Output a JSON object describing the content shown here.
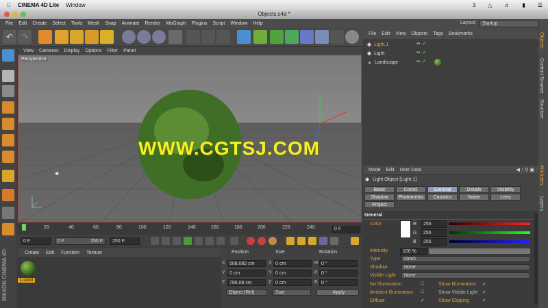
{
  "mac": {
    "app_name": "CINEMA 4D Lite",
    "menu_window": "Window",
    "status_count": "3"
  },
  "window": {
    "title": "Objects.c4d *"
  },
  "app_menu": [
    "File",
    "Edit",
    "Create",
    "Select",
    "Tools",
    "Mesh",
    "Snap",
    "Animate",
    "Render",
    "MoGraph",
    "Plugins",
    "Script",
    "Window",
    "Help"
  ],
  "layout": {
    "label": "Layout:",
    "value": "Startup"
  },
  "viewport": {
    "menu": [
      "View",
      "Cameras",
      "Display",
      "Options",
      "Filter",
      "Panel"
    ],
    "label": "Perspective",
    "watermark": "WWW.CGTSJ.COM"
  },
  "timeline": {
    "ticks": [
      "0",
      "20",
      "40",
      "60",
      "80",
      "100",
      "120",
      "140",
      "160",
      "180",
      "200",
      "220",
      "240"
    ],
    "current_frame": "0 F"
  },
  "transport": {
    "start": "0 F",
    "min": "0 F",
    "max": "250 F",
    "end": "250 F"
  },
  "material": {
    "menu": [
      "Create",
      "Edit",
      "Function",
      "Texture"
    ],
    "name": "Lizard",
    "maxon_logo": "MAXON CINEMA 4D"
  },
  "coordinates": {
    "headers": {
      "position": "Position",
      "size": "Size",
      "rotation": "Rotation"
    },
    "rows": [
      {
        "axis": "X",
        "pos": "508.082 cm",
        "size_axis": "X",
        "size": "0 cm",
        "rot_axis": "H",
        "rot": "0 °"
      },
      {
        "axis": "Y",
        "pos": "0 cm",
        "size_axis": "Y",
        "size": "0 cm",
        "rot_axis": "P",
        "rot": "0 °"
      },
      {
        "axis": "Z",
        "pos": "786.08 cm",
        "size_axis": "Z",
        "size": "0 cm",
        "rot_axis": "B",
        "rot": "0 °"
      }
    ],
    "mode": "Object (Rel)",
    "size_mode": "Size",
    "apply": "Apply"
  },
  "objects": {
    "menu": [
      "File",
      "Edit",
      "View",
      "Objects",
      "Tags",
      "Bookmarks"
    ],
    "items": [
      {
        "name": "Light.1"
      },
      {
        "name": "Light"
      },
      {
        "name": "Landscape"
      }
    ]
  },
  "right_tabs": [
    "Objects",
    "Content Browser",
    "Structure",
    "Attributes",
    "Layers"
  ],
  "attributes": {
    "menu": [
      "Mode",
      "Edit",
      "User Data"
    ],
    "title": "Light Object [Light.1]",
    "tabs_row1": [
      "Basic",
      "Coord.",
      "General",
      "Details",
      "Visibility"
    ],
    "tabs_row2": [
      "Shadow",
      "Photometric",
      "Caustics",
      "Noise",
      "Lens"
    ],
    "tabs_row3": [
      "Project"
    ],
    "active_tab": "General",
    "section": "General",
    "color_label": "Color",
    "rgb": [
      {
        "ch": "R",
        "val": "255"
      },
      {
        "ch": "G",
        "val": "255"
      },
      {
        "ch": "B",
        "val": "255"
      }
    ],
    "intensity_label": "Intensity",
    "intensity_value": "100 %",
    "type_label": "Type",
    "type_value": "Omni",
    "shadow_label": "Shadow",
    "shadow_value": "None",
    "visible_light_label": "Visible Light",
    "visible_light_value": "None",
    "checks_left": [
      "No Illumination",
      "Ambient Illumination",
      "Diffuse"
    ],
    "checks_right": [
      "Show Illumination",
      "Show Visible Light",
      "Show Clipping"
    ]
  }
}
